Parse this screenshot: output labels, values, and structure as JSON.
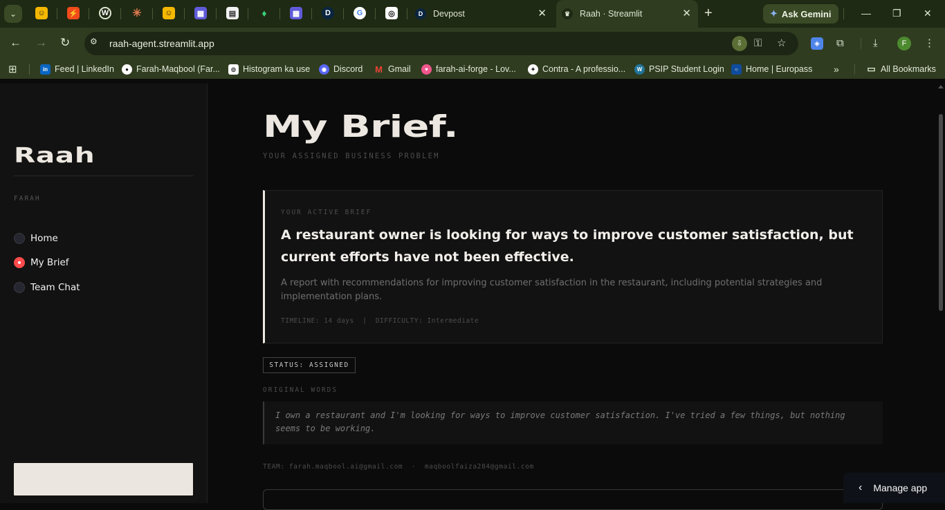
{
  "browser": {
    "tabs": [
      {
        "title": "Devpost"
      },
      {
        "title": "Raah · Streamlit"
      }
    ],
    "pinned_tab_icons": [
      "huggingface-icon",
      "bolt-icon",
      "wordpress-icon",
      "claude-icon",
      "huggingface-icon",
      "linear-icon",
      "calendar-icon",
      "leaf-icon",
      "linear-icon",
      "devpost-icon",
      "google-icon",
      "openai-icon"
    ],
    "gemini_label": "Ask Gemini",
    "url": "raah-agent.streamlit.app",
    "profile_initial": "F",
    "bookmarks": [
      {
        "label": "Feed | LinkedIn"
      },
      {
        "label": "Farah-Maqbool (Far..."
      },
      {
        "label": "Histogram ka use"
      },
      {
        "label": "Discord"
      },
      {
        "label": "Gmail"
      },
      {
        "label": "farah-ai-forge - Lov..."
      },
      {
        "label": "Contra - A professio..."
      },
      {
        "label": "PSIP Student Login"
      },
      {
        "label": "Home | Europass"
      }
    ],
    "all_bookmarks_label": "All Bookmarks"
  },
  "sidebar": {
    "brand": "Raah",
    "user_label": "FARAH",
    "nav": [
      {
        "label": "Home",
        "selected": false
      },
      {
        "label": "My Brief",
        "selected": true
      },
      {
        "label": "Team Chat",
        "selected": false
      }
    ]
  },
  "main": {
    "title": "My Brief.",
    "subtitle": "YOUR ASSIGNED BUSINESS PROBLEM",
    "card": {
      "label": "YOUR ACTIVE BRIEF",
      "title": "A restaurant owner is looking for ways to improve customer satisfaction, but current efforts have not been effective.",
      "description": "A report with recommendations for improving customer satisfaction in the restaurant, including potential strategies and implementation plans.",
      "meta": "TIMELINE: 14 days  |  DIFFICULTY: Intermediate"
    },
    "status": "STATUS: ASSIGNED",
    "original_label": "ORIGINAL WORDS",
    "original_quote": "I own a restaurant and I'm looking for ways to improve customer satisfaction. I've tried a few things, but nothing seems to be working.",
    "team": "TEAM: farah.maqbool.ai@gmail.com  ·  maqboolfaiza284@gmail.com"
  },
  "manage_app_label": "Manage app",
  "colors": {
    "accent_radio": "#ff4b4b",
    "brand_text": "#ece8e1",
    "background": "#0b0b0b",
    "browser_frame": "#2f3c20"
  }
}
